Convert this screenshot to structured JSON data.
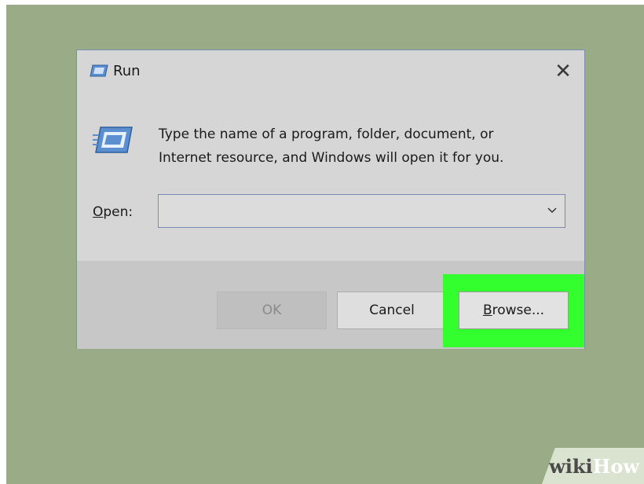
{
  "dialog": {
    "title": "Run",
    "close_glyph": "✕",
    "description_line1": "Type the name of a program, folder, document, or",
    "description_line2": "Internet resource, and Windows will open it for you.",
    "open_label_access_key": "O",
    "open_label_rest": "pen:",
    "open_input_value": "",
    "buttons": {
      "ok": "OK",
      "cancel": "Cancel",
      "browse_access_key": "B",
      "browse_rest": "rowse..."
    },
    "icons": {
      "title": "run-icon",
      "large": "run-icon",
      "dropdown": "chevron-down-icon",
      "close": "close-icon"
    }
  },
  "highlight": {
    "color": "#33ff2e",
    "target": "browse-button"
  },
  "watermark": {
    "part1": "wiki",
    "part2": "How"
  },
  "colors": {
    "desktop": "#9aab87",
    "dialog_body": "#d6d6d6",
    "dialog_footer": "#c7c7c7",
    "dialog_border": "#7b8fb1"
  }
}
